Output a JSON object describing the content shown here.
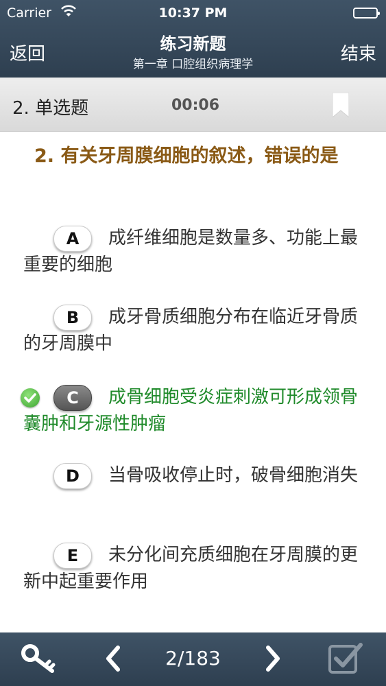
{
  "status": {
    "carrier": "Carrier",
    "time": "10:37 PM",
    "battery_level": 1.0
  },
  "nav": {
    "back_label": "返回",
    "title": "练习新题",
    "subtitle": "第一章  口腔组织病理学",
    "end_label": "结束"
  },
  "question_bar": {
    "type_label": "2. 单选题",
    "timer": "00:06"
  },
  "question": {
    "text": "2. 有关牙周膜细胞的叙述，错误的是"
  },
  "options": [
    {
      "letter": "A",
      "text": "成纤维细胞是数量多、功能上最重要的细胞",
      "selected": false,
      "correct": false
    },
    {
      "letter": "B",
      "text": "成牙骨质细胞分布在临近牙骨质的牙周膜中",
      "selected": false,
      "correct": false
    },
    {
      "letter": "C",
      "text": "成骨细胞受炎症刺激可形成领骨囊肿和牙源性肿瘤",
      "selected": true,
      "correct": true
    },
    {
      "letter": "D",
      "text": "当骨吸收停止时，破骨细胞消失",
      "selected": false,
      "correct": false
    },
    {
      "letter": "E",
      "text": "未分化间充质细胞在牙周膜的更新中起重要作用",
      "selected": false,
      "correct": false
    }
  ],
  "toolbar": {
    "page_indicator": "2/183",
    "icons": [
      "key-icon",
      "prev-arrow-icon",
      "next-arrow-icon",
      "checkbox-icon"
    ]
  },
  "colors": {
    "nav_bg": "#34475a",
    "question_text": "#8a5a16",
    "correct_text": "#1f8a2a"
  }
}
